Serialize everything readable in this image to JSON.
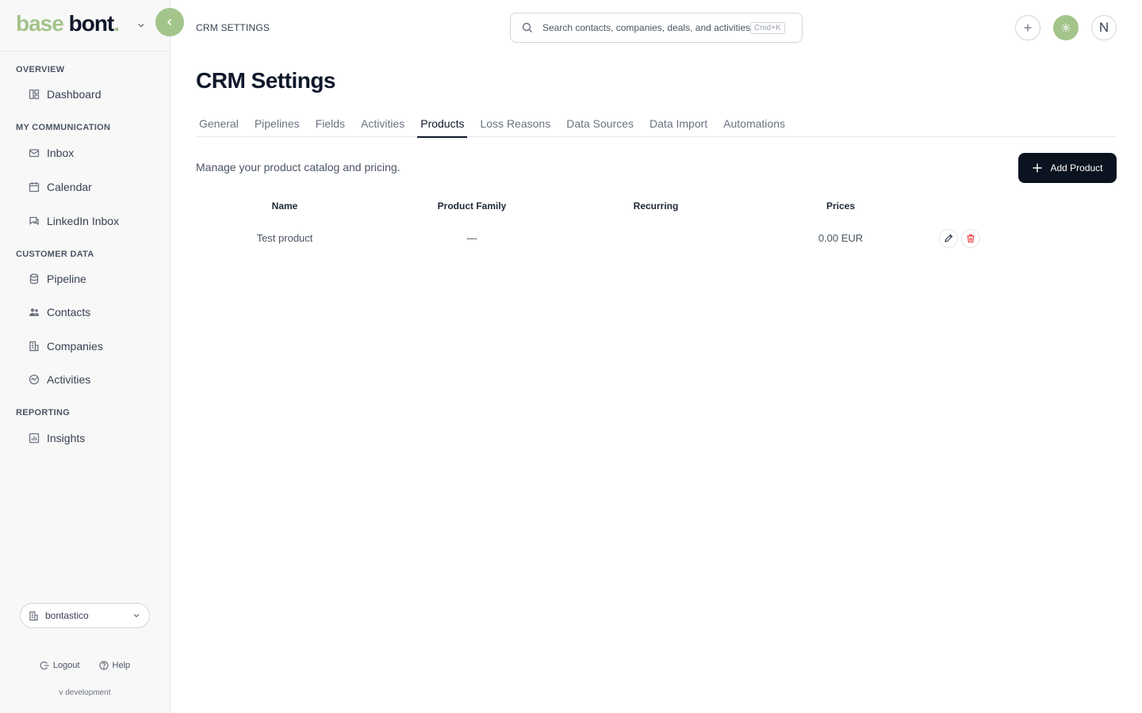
{
  "brand": {
    "logo_part1": "base",
    "logo_part2": "bont",
    "logo_dot": "."
  },
  "sidebar": {
    "sections": [
      {
        "label": "OVERVIEW",
        "items": [
          {
            "label": "Dashboard",
            "icon": "dashboard-icon"
          }
        ]
      },
      {
        "label": "MY COMMUNICATION",
        "items": [
          {
            "label": "Inbox",
            "icon": "mail-icon"
          },
          {
            "label": "Calendar",
            "icon": "calendar-icon"
          },
          {
            "label": "LinkedIn Inbox",
            "icon": "chat-icon"
          }
        ]
      },
      {
        "label": "CUSTOMER DATA",
        "items": [
          {
            "label": "Pipeline",
            "icon": "database-icon"
          },
          {
            "label": "Contacts",
            "icon": "users-icon"
          },
          {
            "label": "Companies",
            "icon": "building-icon"
          },
          {
            "label": "Activities",
            "icon": "activity-icon"
          }
        ]
      },
      {
        "label": "REPORTING",
        "items": [
          {
            "label": "Insights",
            "icon": "chart-icon"
          }
        ]
      }
    ],
    "org": {
      "name": "bontastico"
    },
    "footer": {
      "logout": "Logout",
      "help": "Help",
      "version": "v development"
    }
  },
  "header": {
    "breadcrumb": "CRM SETTINGS",
    "search": {
      "placeholder": "Search contacts, companies, deals, and activities",
      "shortcut": "Cmd+K"
    },
    "avatar_initial": "N"
  },
  "main": {
    "title": "CRM Settings",
    "tabs": [
      {
        "label": "General"
      },
      {
        "label": "Pipelines"
      },
      {
        "label": "Fields"
      },
      {
        "label": "Activities"
      },
      {
        "label": "Products",
        "active": true
      },
      {
        "label": "Loss Reasons"
      },
      {
        "label": "Data Sources"
      },
      {
        "label": "Data Import"
      },
      {
        "label": "Automations"
      }
    ],
    "description": "Manage your product catalog and pricing.",
    "add_button": "Add Product",
    "table": {
      "columns": [
        "Name",
        "Product Family",
        "Recurring",
        "Prices"
      ],
      "rows": [
        {
          "name": "Test product",
          "family": "—",
          "recurring": "",
          "price": "0.00 EUR"
        }
      ]
    }
  },
  "colors": {
    "accent": "#a3c48a",
    "primary": "#0b1220",
    "danger": "#ef4444"
  }
}
